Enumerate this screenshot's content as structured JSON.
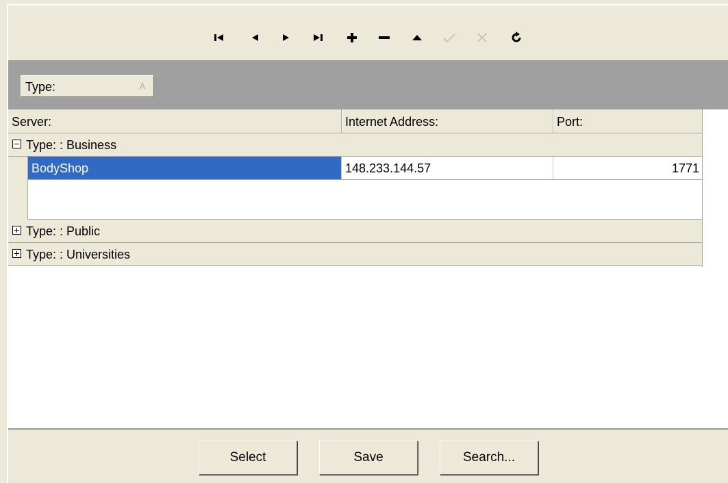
{
  "toolbar": {
    "buttons": [
      {
        "name": "first-record-icon",
        "enabled": true
      },
      {
        "name": "prior-record-icon",
        "enabled": true
      },
      {
        "name": "next-record-icon",
        "enabled": true
      },
      {
        "name": "last-record-icon",
        "enabled": true
      },
      {
        "name": "insert-record-icon",
        "enabled": true
      },
      {
        "name": "delete-record-icon",
        "enabled": true
      },
      {
        "name": "edit-record-icon",
        "enabled": true
      },
      {
        "name": "post-edit-icon",
        "enabled": false
      },
      {
        "name": "cancel-edit-icon",
        "enabled": false
      },
      {
        "name": "refresh-icon",
        "enabled": true
      }
    ]
  },
  "group_panel": {
    "chip_label": "Type:",
    "sort_icon": "sort-ascending-icon"
  },
  "grid": {
    "columns": [
      "Server:",
      "Internet Address:",
      "Port:"
    ],
    "groups": [
      {
        "label": "Type: : Business",
        "expanded": true
      },
      {
        "label": "Type: : Public",
        "expanded": false
      },
      {
        "label": "Type: : Universities",
        "expanded": false
      }
    ],
    "rows": [
      {
        "server": "BodyShop",
        "address": "148.233.144.57",
        "port": "1771"
      }
    ]
  },
  "footer": {
    "select_label": "Select",
    "save_label": "Save",
    "search_label": "Search..."
  },
  "colors": {
    "selection": "#316ac5",
    "panel": "#ece9d8",
    "group_box": "#a0a0a0"
  }
}
